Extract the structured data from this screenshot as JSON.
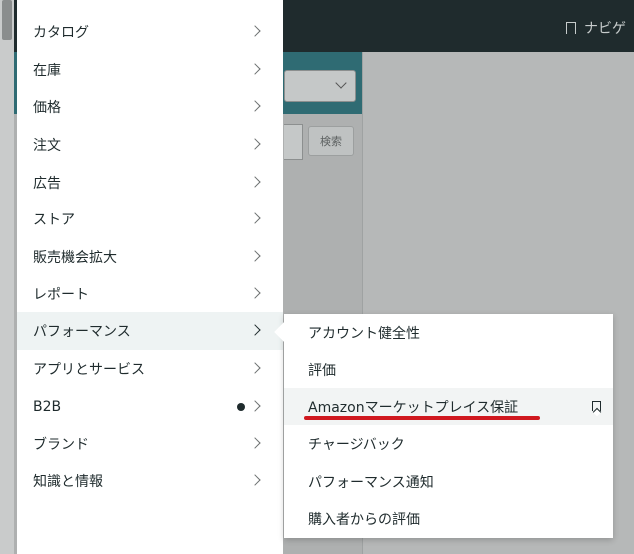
{
  "background": {
    "nav_label": "ナビゲ",
    "search_button": "検索"
  },
  "menu": {
    "items": [
      {
        "label": "カタログ"
      },
      {
        "label": "在庫"
      },
      {
        "label": "価格"
      },
      {
        "label": "注文"
      },
      {
        "label": "広告"
      },
      {
        "label": "ストア"
      },
      {
        "label": "販売機会拡大"
      },
      {
        "label": "レポート"
      },
      {
        "label": "パフォーマンス",
        "active": true
      },
      {
        "label": "アプリとサービス"
      },
      {
        "label": "B2B",
        "has_dot": true
      },
      {
        "label": "ブランド"
      },
      {
        "label": "知識と情報"
      }
    ]
  },
  "submenu": {
    "items": [
      {
        "label": "アカウント健全性"
      },
      {
        "label": "評価"
      },
      {
        "label": "Amazonマーケットプレイス保証",
        "hovered": true,
        "bookmark_icon": "bookmark-icon"
      },
      {
        "label": "チャージバック"
      },
      {
        "label": "パフォーマンス通知"
      },
      {
        "label": "購入者からの評価"
      }
    ]
  },
  "annotation": {
    "underline_color": "#d0181f"
  }
}
